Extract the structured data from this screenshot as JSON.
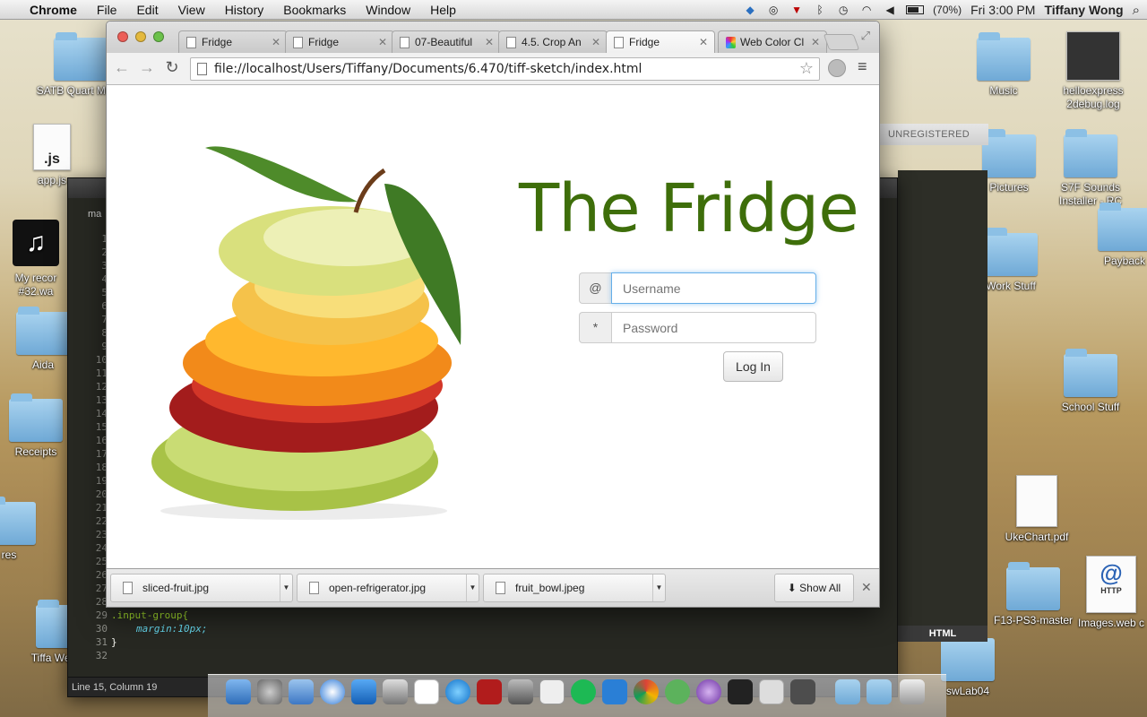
{
  "menubar": {
    "app": "Chrome",
    "items": [
      "File",
      "Edit",
      "View",
      "History",
      "Bookmarks",
      "Window",
      "Help"
    ],
    "battery": "(70%)",
    "clock": "Fri 3:00 PM",
    "user": "Tiffany Wong"
  },
  "desktop": {
    "left_icons": [
      "SATB Quart Music",
      "app.js",
      "My recor #32.wa",
      "Aida",
      "Receipts",
      "res",
      "Tiffa Wee"
    ],
    "right_icons": [
      "Music",
      "helloexpress 2debug.log",
      "Pictures",
      "S7F Sounds Installer - RC",
      "Payback",
      "Work Stuff",
      "School Stuff",
      "UkeChart.pdf",
      "F13-PS3-master",
      "Images.web c",
      "swLab04"
    ],
    "js_label": ".js",
    "http_label": "HTTP"
  },
  "editor": {
    "tab_label": "ma",
    "unregistered": "UNREGISTERED",
    "syntax": "HTML",
    "status": "Line 15, Column 19",
    "line_numbers": [
      "1",
      "2",
      "3",
      "4",
      "5",
      "6",
      "7",
      "8",
      "9",
      "10",
      "11",
      "12",
      "13",
      "14",
      "15",
      "16",
      "17",
      "18",
      "19",
      "20",
      "21",
      "22",
      "23",
      "24",
      "25",
      "26",
      "27",
      "28",
      "29",
      "30",
      "31",
      "32"
    ],
    "code": [
      ".input-group{",
      "margin:10px;",
      "}"
    ]
  },
  "browser": {
    "tabs": [
      {
        "label": "Fridge",
        "active": false
      },
      {
        "label": "Fridge",
        "active": false
      },
      {
        "label": "07-Beautiful",
        "active": false
      },
      {
        "label": "4.5. Crop An",
        "active": false
      },
      {
        "label": "Fridge",
        "active": true
      },
      {
        "label": "Web Color Cl",
        "active": false
      }
    ],
    "url": "file://localhost/Users/Tiffany/Documents/6.470/tiff-sketch/index.html"
  },
  "page": {
    "title": "The Fridge",
    "username_addon": "@",
    "username_placeholder": "Username",
    "password_addon": "*",
    "password_placeholder": "Password",
    "login_label": "Log In"
  },
  "downloads": {
    "items": [
      "sliced-fruit.jpg",
      "open-refrigerator.jpg",
      "fruit_bowl.jpeg"
    ],
    "show_all": "Show All"
  },
  "colors": {
    "brand": "#3e6e0a",
    "focus": "#66afe9"
  }
}
